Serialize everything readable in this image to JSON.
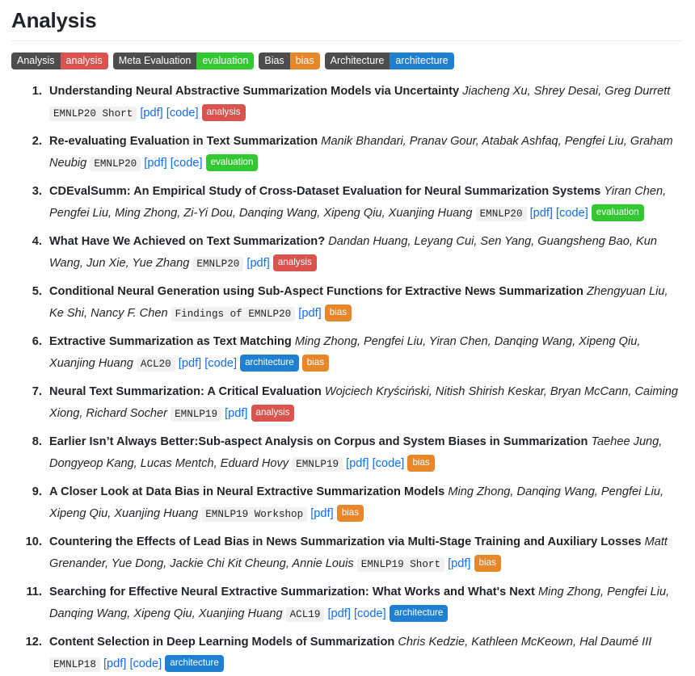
{
  "header": {
    "title": "Analysis"
  },
  "colors": {
    "tag_name_bg": "#4d4d4d",
    "analysis": "#d9534f",
    "evaluation": "#32c832",
    "bias": "#e8862a",
    "architecture": "#1f7fd1",
    "link": "#0d6efd",
    "venue_bg": "#f1f1f1",
    "divider": "#e9ecef"
  },
  "tag_filters": [
    {
      "name": "Analysis",
      "key": "analysis",
      "color": "#d9534f"
    },
    {
      "name": "Meta Evaluation",
      "key": "evaluation",
      "color": "#32c832"
    },
    {
      "name": "Bias",
      "key": "bias",
      "color": "#e8862a"
    },
    {
      "name": "Architecture",
      "key": "architecture",
      "color": "#1f7fd1"
    }
  ],
  "links": {
    "pdf": "[pdf]",
    "code": "[code]"
  },
  "papers": [
    {
      "index": "1",
      "title": "Understanding Neural Abstractive Summarization Models via Uncertainty",
      "authors": "Jiacheng Xu, Shrey Desai, Greg Durrett",
      "venue": "EMNLP20 Short",
      "has_pdf": true,
      "has_code": true,
      "tags": [
        {
          "key": "analysis",
          "color": "#d9534f"
        }
      ]
    },
    {
      "index": "2",
      "title": "Re-evaluating Evaluation in Text Summarization",
      "authors": "Manik Bhandari, Pranav Gour, Atabak Ashfaq, Pengfei Liu, Graham Neubig",
      "venue": "EMNLP20",
      "has_pdf": true,
      "has_code": true,
      "tags": [
        {
          "key": "evaluation",
          "color": "#32c832"
        }
      ]
    },
    {
      "index": "3",
      "title": "CDEvalSumm: An Empirical Study of Cross-Dataset Evaluation for Neural Summarization Systems",
      "authors": "Yiran Chen, Pengfei Liu, Ming Zhong, Zi-Yi Dou, Danqing Wang, Xipeng Qiu, Xuanjing Huang",
      "venue": "EMNLP20",
      "has_pdf": true,
      "has_code": true,
      "tags": [
        {
          "key": "evaluation",
          "color": "#32c832"
        }
      ]
    },
    {
      "index": "4",
      "title": "What Have We Achieved on Text Summarization?",
      "authors": "Dandan Huang, Leyang Cui, Sen Yang, Guangsheng Bao, Kun Wang, Jun Xie, Yue Zhang",
      "venue": "EMNLP20",
      "has_pdf": true,
      "has_code": false,
      "tags": [
        {
          "key": "analysis",
          "color": "#d9534f"
        }
      ]
    },
    {
      "index": "5",
      "title": "Conditional Neural Generation using Sub-Aspect Functions for Extractive News Summarization",
      "authors": "Zhengyuan Liu, Ke Shi, Nancy F. Chen",
      "venue": "Findings of EMNLP20",
      "has_pdf": true,
      "has_code": false,
      "tags": [
        {
          "key": "bias",
          "color": "#e8862a"
        }
      ]
    },
    {
      "index": "6",
      "title": "Extractive Summarization as Text Matching",
      "authors": "Ming Zhong, Pengfei Liu, Yiran Chen, Danqing Wang, Xipeng Qiu, Xuanjing Huang",
      "venue": "ACL20",
      "has_pdf": true,
      "has_code": true,
      "tags": [
        {
          "key": "architecture",
          "color": "#1f7fd1"
        },
        {
          "key": "bias",
          "color": "#e8862a"
        }
      ]
    },
    {
      "index": "7",
      "title": "Neural Text Summarization: A Critical Evaluation",
      "authors": "Wojciech Kryściński, Nitish Shirish Keskar, Bryan McCann, Caiming Xiong, Richard Socher",
      "venue": "EMNLP19",
      "has_pdf": true,
      "has_code": false,
      "tags": [
        {
          "key": "analysis",
          "color": "#d9534f"
        }
      ]
    },
    {
      "index": "8",
      "title": "Earlier Isn’t Always Better:Sub-aspect Analysis on Corpus and System Biases in Summarization",
      "authors": "Taehee Jung, Dongyeop Kang, Lucas Mentch, Eduard Hovy",
      "venue": "EMNLP19",
      "has_pdf": true,
      "has_code": true,
      "tags": [
        {
          "key": "bias",
          "color": "#e8862a"
        }
      ]
    },
    {
      "index": "9",
      "title": "A Closer Look at Data Bias in Neural Extractive Summarization Models",
      "authors": "Ming Zhong, Danqing Wang, Pengfei Liu, Xipeng Qiu, Xuanjing Huang",
      "venue": "EMNLP19 Workshop",
      "has_pdf": true,
      "has_code": false,
      "tags": [
        {
          "key": "bias",
          "color": "#e8862a"
        }
      ]
    },
    {
      "index": "10",
      "title": "Countering the Effects of Lead Bias in News Summarization via Multi-Stage Training and Auxiliary Losses",
      "authors": "Matt Grenander, Yue Dong, Jackie Chi Kit Cheung, Annie Louis",
      "venue": "EMNLP19 Short",
      "has_pdf": true,
      "has_code": false,
      "tags": [
        {
          "key": "bias",
          "color": "#e8862a"
        }
      ]
    },
    {
      "index": "11",
      "title": "Searching for Effective Neural Extractive Summarization: What Works and What's Next",
      "authors": "Ming Zhong, Pengfei Liu, Danqing Wang, Xipeng Qiu, Xuanjing Huang",
      "venue": "ACL19",
      "has_pdf": true,
      "has_code": true,
      "tags": [
        {
          "key": "architecture",
          "color": "#1f7fd1"
        }
      ]
    },
    {
      "index": "12",
      "title": "Content Selection in Deep Learning Models of Summarization",
      "authors": "Chris Kedzie, Kathleen McKeown, Hal Daumé III",
      "venue": "EMNLP18",
      "has_pdf": true,
      "has_code": true,
      "tags": [
        {
          "key": "architecture",
          "color": "#1f7fd1"
        }
      ]
    }
  ]
}
